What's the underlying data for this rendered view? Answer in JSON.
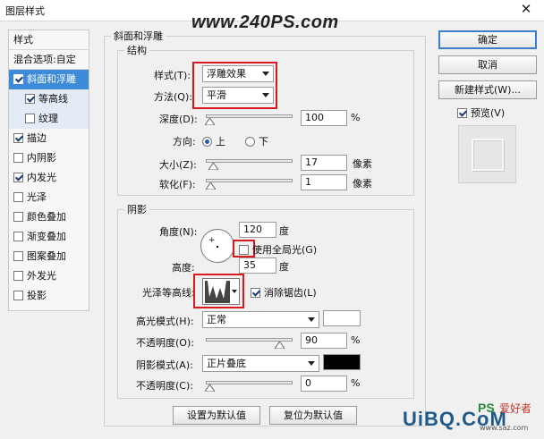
{
  "window": {
    "title": "图层样式",
    "close": "✕"
  },
  "watermark": "www.240PS.com",
  "left_panel": {
    "header": "样式",
    "blend_options": "混合选项:自定",
    "items": [
      {
        "label": "斜面和浮雕",
        "checked": true,
        "selected": true
      },
      {
        "label": "等高线",
        "checked": true,
        "sub": true
      },
      {
        "label": "纹理",
        "checked": false,
        "sub": true
      },
      {
        "label": "描边",
        "checked": true
      },
      {
        "label": "内阴影",
        "checked": false
      },
      {
        "label": "内发光",
        "checked": true
      },
      {
        "label": "光泽",
        "checked": false
      },
      {
        "label": "颜色叠加",
        "checked": false
      },
      {
        "label": "渐变叠加",
        "checked": false
      },
      {
        "label": "图案叠加",
        "checked": false
      },
      {
        "label": "外发光",
        "checked": false
      },
      {
        "label": "投影",
        "checked": false
      }
    ]
  },
  "bevel": {
    "legend": "斜面和浮雕",
    "structure": {
      "legend": "结构",
      "style_label": "样式(T):",
      "style_value": "浮雕效果",
      "method_label": "方法(Q):",
      "method_value": "平滑",
      "depth_label": "深度(D):",
      "depth_value": "100",
      "depth_unit": "%",
      "depth_level": 0.0,
      "direction_label": "方向:",
      "dir_up": "上",
      "dir_down": "下",
      "size_label": "大小(Z):",
      "size_value": "17",
      "size_unit": "像素",
      "soften_label": "软化(F):",
      "soften_value": "1",
      "soften_unit": "像素"
    },
    "shading": {
      "legend": "阴影",
      "angle_label": "角度(N):",
      "angle_value": "120",
      "angle_unit": "度",
      "global_light": "使用全局光(G)",
      "altitude_label": "高度:",
      "altitude_value": "35",
      "altitude_unit": "度",
      "gloss_label": "光泽等高线:",
      "antialias": "消除锯齿(L)",
      "highlight_mode_label": "高光模式(H):",
      "highlight_mode_value": "正常",
      "highlight_color": "#ffffff",
      "opacity1_label": "不透明度(O):",
      "opacity1_value": "90",
      "opacity1_unit": "%",
      "opacity1_level": 0.9,
      "shadow_mode_label": "阴影模式(A):",
      "shadow_mode_value": "正片叠底",
      "shadow_color": "#000000",
      "opacity2_label": "不透明度(C):",
      "opacity2_value": "0",
      "opacity2_unit": "%",
      "opacity2_level": 0.0
    },
    "make_default": "设置为默认值",
    "reset_default": "复位为默认值"
  },
  "buttons": {
    "ok": "确定",
    "cancel": "取消",
    "new_style": "新建样式(W)...",
    "preview": "预览(V)"
  },
  "logo": {
    "text1": "UiBQ.CoM",
    "text2": "PS",
    "text3": "爱好者",
    "text4": "www.saz.com"
  },
  "colors": {
    "selected": "#3c8ad8",
    "highlight_box": "#d9191d",
    "accent": "#3c7fc8"
  }
}
